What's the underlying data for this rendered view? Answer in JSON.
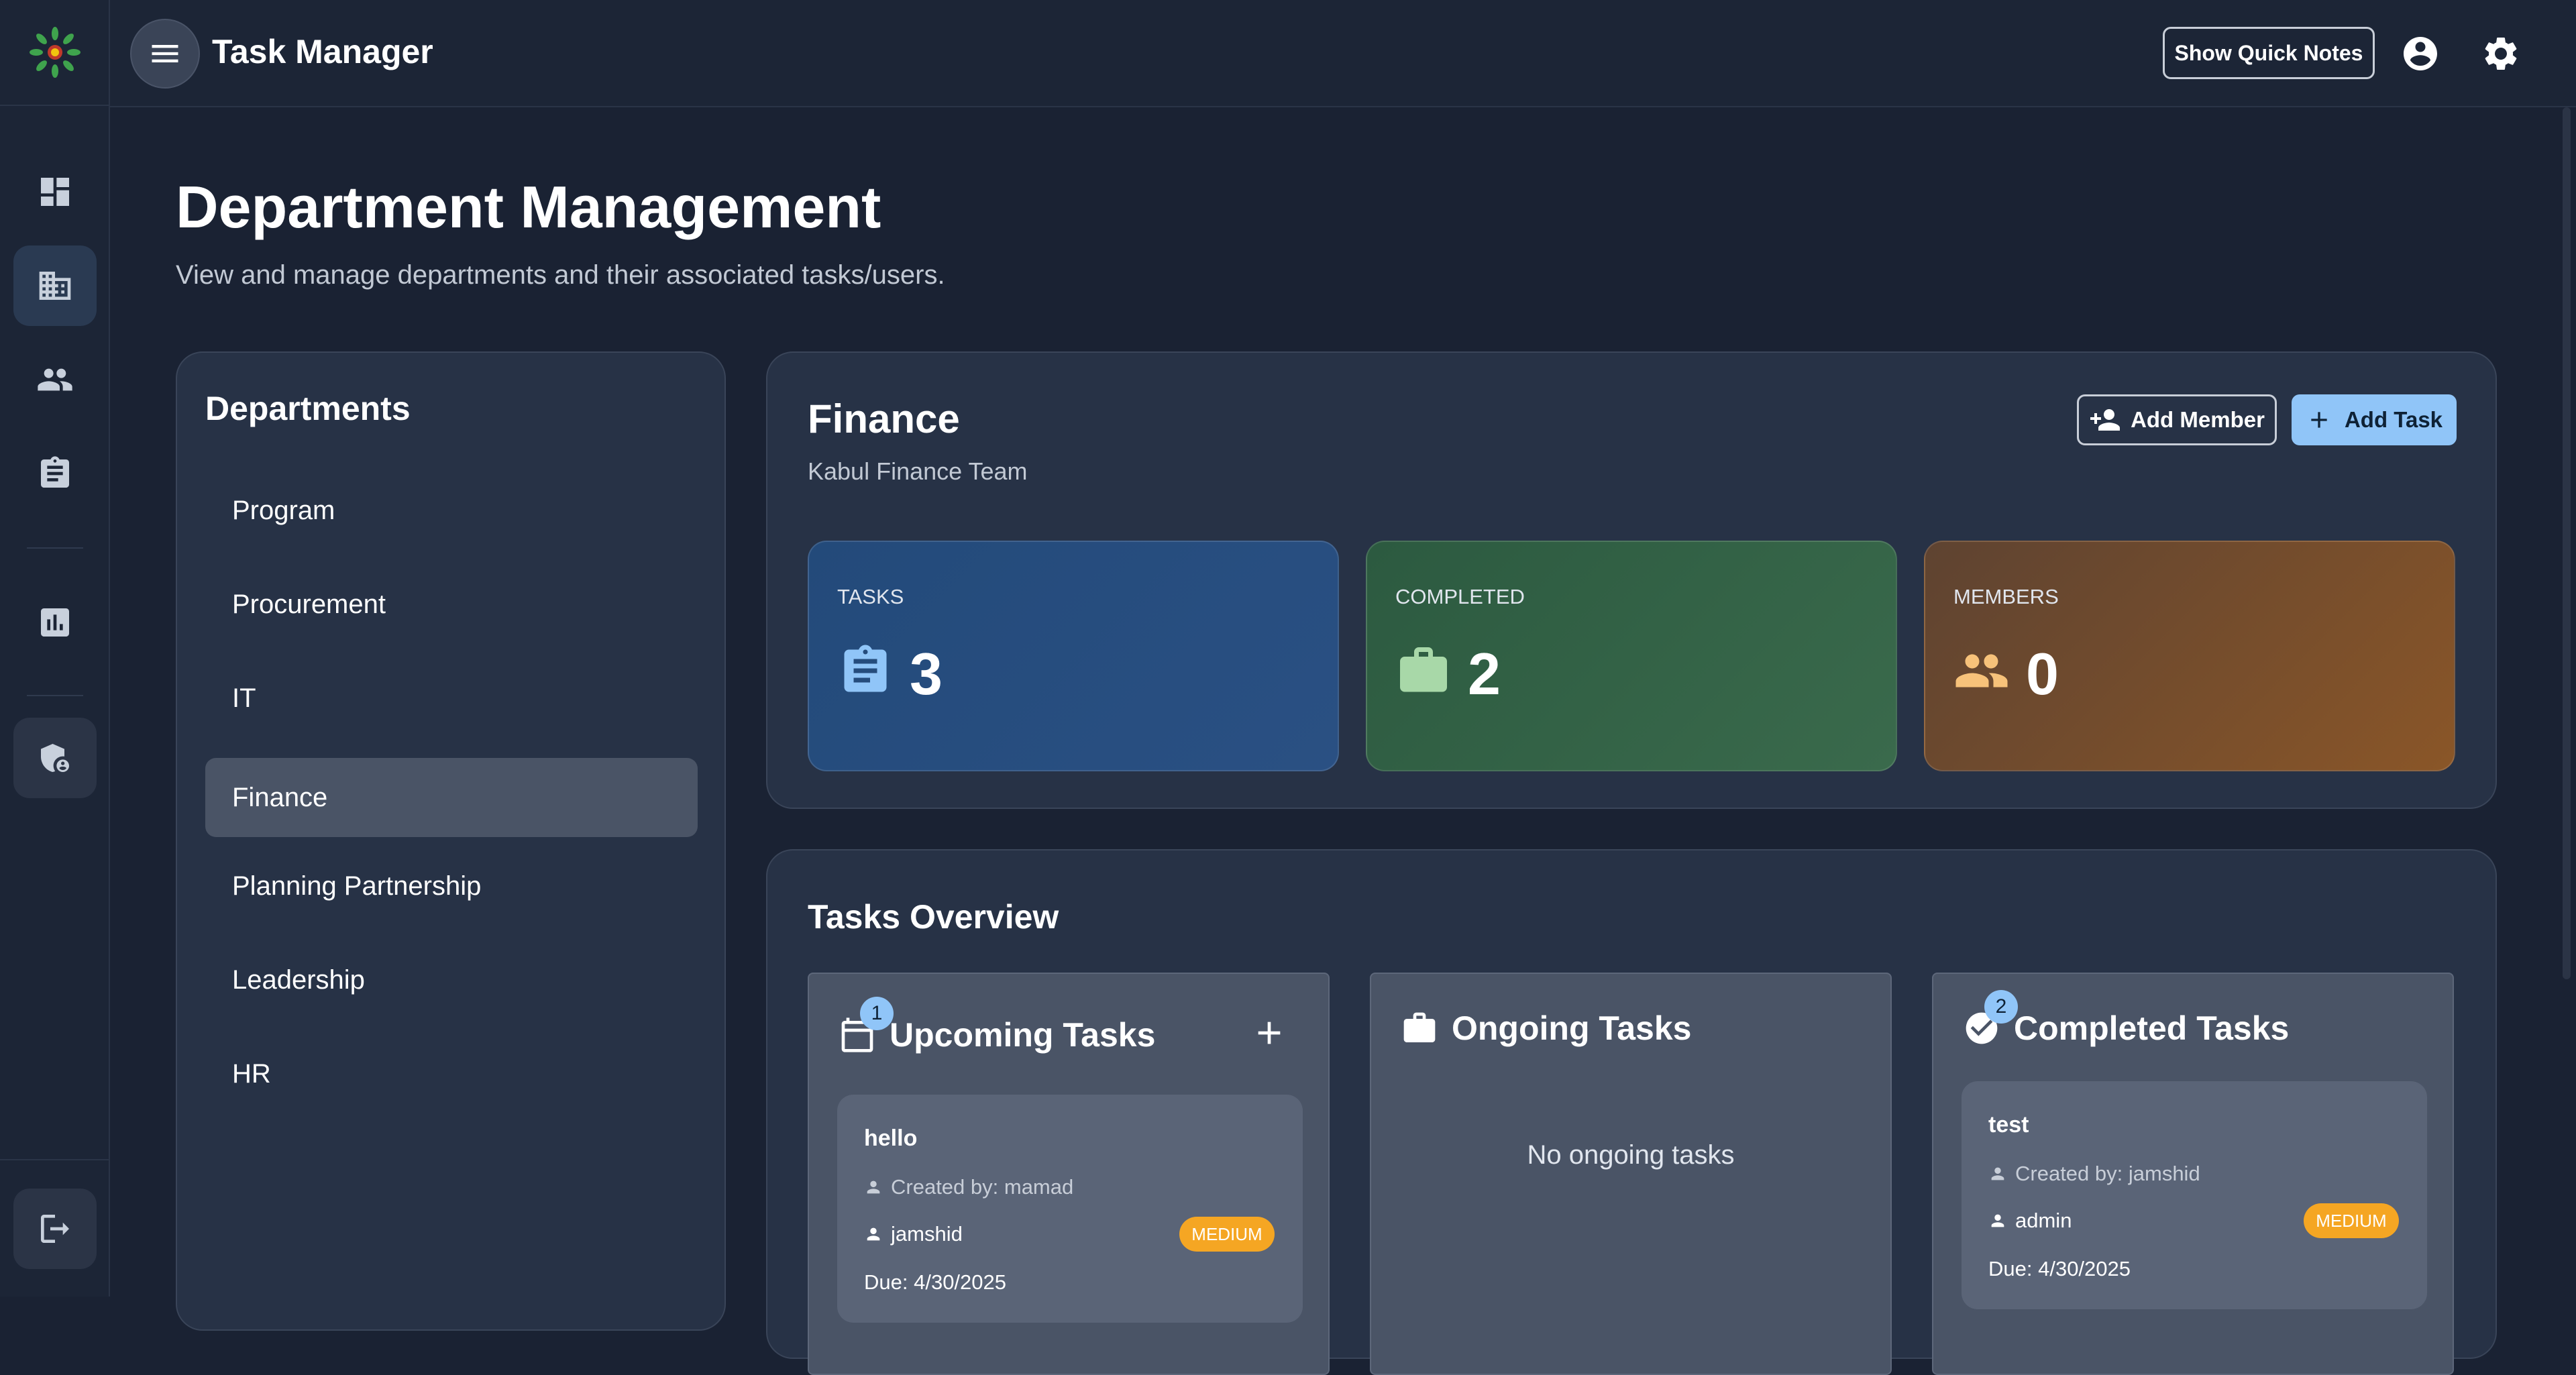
{
  "header": {
    "title": "Task Manager",
    "quick_notes_label": "Show Quick Notes"
  },
  "page": {
    "title": "Department Management",
    "subtitle": "View and manage departments and their associated tasks/users."
  },
  "departments": {
    "heading": "Departments",
    "items": [
      {
        "label": "Program"
      },
      {
        "label": "Procurement"
      },
      {
        "label": "IT"
      },
      {
        "label": "Finance",
        "selected": true
      },
      {
        "label": "Planning Partnership"
      },
      {
        "label": "Leadership"
      },
      {
        "label": "HR"
      }
    ]
  },
  "department_detail": {
    "name": "Finance",
    "description": "Kabul Finance Team",
    "add_member_label": "Add Member",
    "add_task_label": "Add Task",
    "stats": {
      "tasks": {
        "label": "TASKS",
        "value": "3"
      },
      "completed": {
        "label": "COMPLETED",
        "value": "2"
      },
      "members": {
        "label": "MEMBERS",
        "value": "0"
      }
    }
  },
  "overview": {
    "title": "Tasks Overview",
    "upcoming": {
      "title": "Upcoming Tasks",
      "count": "1",
      "tasks": [
        {
          "name": "hello",
          "created_by": "Created by: mamad",
          "assignee": "jamshid",
          "priority": "MEDIUM",
          "due": "Due: 4/30/2025"
        }
      ]
    },
    "ongoing": {
      "title": "Ongoing Tasks",
      "empty_text": "No ongoing tasks"
    },
    "completed": {
      "title": "Completed Tasks",
      "count": "2",
      "tasks": [
        {
          "name": "test",
          "created_by": "Created by: jamshid",
          "assignee": "admin",
          "priority": "MEDIUM",
          "due": "Due: 4/30/2025"
        }
      ]
    }
  },
  "colors": {
    "accent": "#90c5f8",
    "priority_medium": "#f5a623",
    "background": "#1a2233"
  }
}
